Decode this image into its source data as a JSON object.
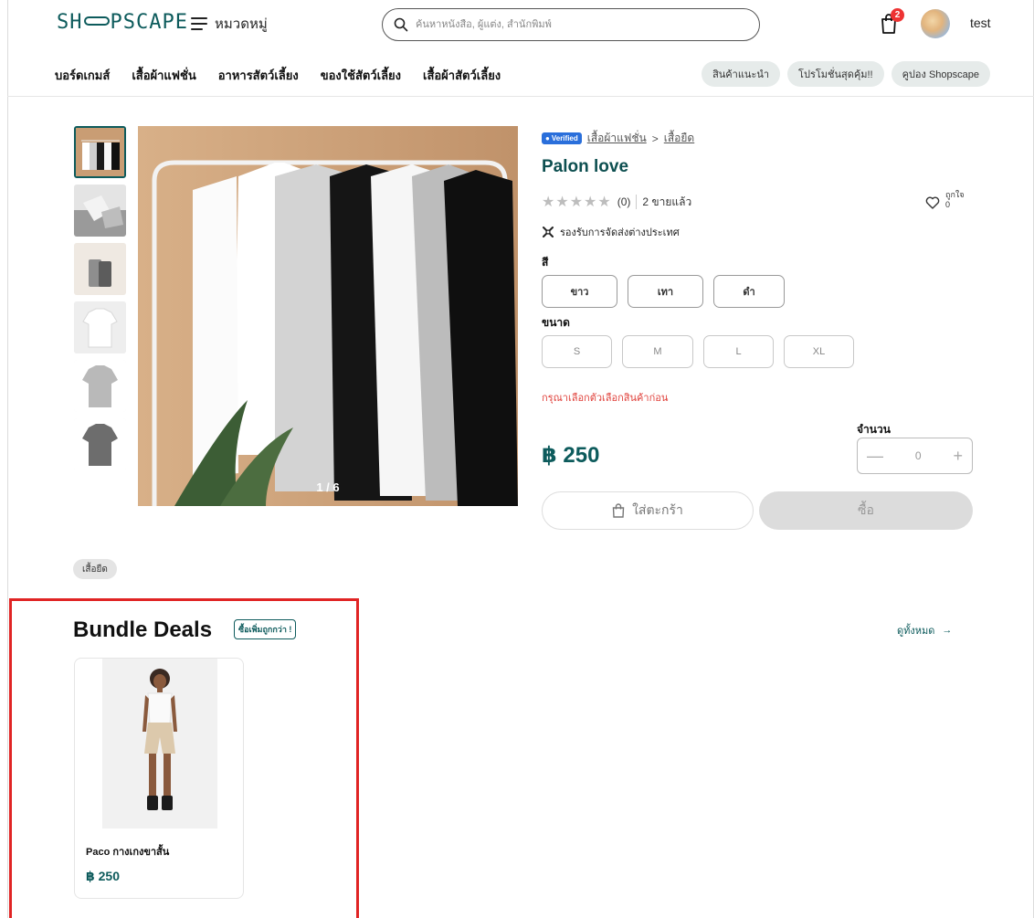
{
  "header": {
    "logo_text_left": "SH",
    "logo_text_right": "PSCAPE",
    "category_label": "หมวดหมู่",
    "search_placeholder": "ค้นหาหนังสือ, ผู้แต่ง, สำนักพิมพ์",
    "cart_count": "2",
    "username": "test"
  },
  "nav": {
    "items": [
      "บอร์ดเกมส์",
      "เสื้อผ้าแฟชั่น",
      "อาหารสัตว์เลี้ยง",
      "ของใช้สัตว์เลี้ยง",
      "เสื้อผ้าสัตว์เลี้ยง"
    ],
    "chips": [
      "สินค้าแนะนำ",
      "โปรโมชั่นสุดคุ้ม!!",
      "คูปอง Shopscape"
    ]
  },
  "gallery": {
    "counter": "1 / 6"
  },
  "product": {
    "verified_label": "Verified",
    "breadcrumb": [
      "เสื้อผ้าแฟชั่น",
      "เสื้อยืด"
    ],
    "breadcrumb_separator": ">",
    "title": "Palon love",
    "rating_count": "(0)",
    "sold": "2 ขายแล้ว",
    "like_label": "ถูกใจ",
    "like_count": "0",
    "shipping": "รองรับการจัดส่งต่างประเทศ",
    "color_label": "สี",
    "colors": [
      "ขาว",
      "เทา",
      "ดำ"
    ],
    "size_label": "ขนาด",
    "sizes": [
      "S",
      "M",
      "L",
      "XL"
    ],
    "warning": "กรุณาเลือกตัวเลือกสินค้าก่อน",
    "qty_label": "จำนวน",
    "qty_value": "0",
    "price": "฿ 250",
    "add_to_cart": "ใส่ตะกร้า",
    "buy": "ซื้อ"
  },
  "tags": [
    "เสื้อยืด"
  ],
  "bundle": {
    "title": "Bundle Deals",
    "badge": "ซื้อเพิ่มถูกกว่า !",
    "see_all": "ดูทั้งหมด",
    "items": [
      {
        "name": "Paco กางเกงขาสั้น",
        "price": "฿ 250"
      }
    ]
  }
}
